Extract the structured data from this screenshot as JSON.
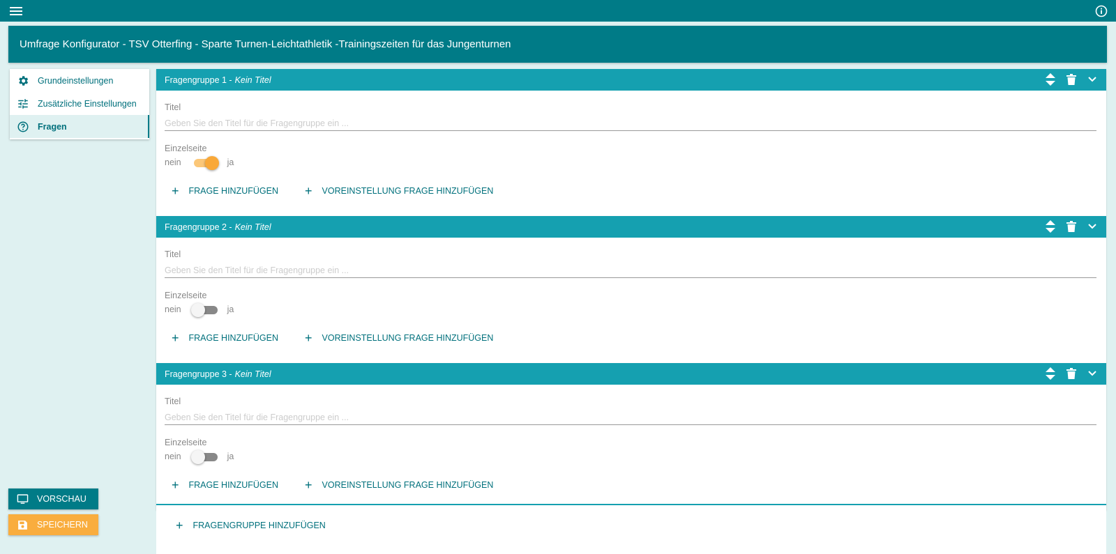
{
  "topbar": {
    "menu_icon": "hamburger-menu-icon",
    "info_icon": "info-icon"
  },
  "header": {
    "title": "Umfrage Konfigurator - TSV Otterfing - Sparte Turnen-Leichtathletik -Trainingszeiten für das Jungenturnen"
  },
  "sidebar": {
    "items": [
      {
        "label": "Grundeinstellungen",
        "icon": "gear-icon",
        "active": false
      },
      {
        "label": "Zusätzliche Einstellungen",
        "icon": "tune-icon",
        "active": false
      },
      {
        "label": "Fragen",
        "icon": "help-circle-icon",
        "active": true
      }
    ]
  },
  "groups": [
    {
      "prefix": "Fragengruppe 1 -",
      "subtitle": "Kein Titel",
      "title_label": "Titel",
      "title_placeholder": "Geben Sie den Titel für die Fragengruppe ein ...",
      "single_label": "Einzelseite",
      "off_label": "nein",
      "on_label": "ja",
      "single_page": true,
      "add_question": "FRAGE HINZUFÜGEN",
      "add_preset": "VOREINSTELLUNG FRAGE HINZUFÜGEN"
    },
    {
      "prefix": "Fragengruppe 2 -",
      "subtitle": "Kein Titel",
      "title_label": "Titel",
      "title_placeholder": "Geben Sie den Titel für die Fragengruppe ein ...",
      "single_label": "Einzelseite",
      "off_label": "nein",
      "on_label": "ja",
      "single_page": false,
      "add_question": "FRAGE HINZUFÜGEN",
      "add_preset": "VOREINSTELLUNG FRAGE HINZUFÜGEN"
    },
    {
      "prefix": "Fragengruppe 3 -",
      "subtitle": "Kein Titel",
      "title_label": "Titel",
      "title_placeholder": "Geben Sie den Titel für die Fragengruppe ein ...",
      "single_label": "Einzelseite",
      "off_label": "nein",
      "on_label": "ja",
      "single_page": false,
      "add_question": "FRAGE HINZUFÜGEN",
      "add_preset": "VOREINSTELLUNG FRAGE HINZUFÜGEN"
    }
  ],
  "add_group_label": "FRAGENGRUPPE HINZUFÜGEN",
  "buttons": {
    "preview": "VORSCHAU",
    "save": "SPEICHERN"
  },
  "colors": {
    "primary": "#007b87",
    "group_header": "#15a0b0",
    "accent": "#f9ad3e",
    "background": "#dff1f1"
  }
}
